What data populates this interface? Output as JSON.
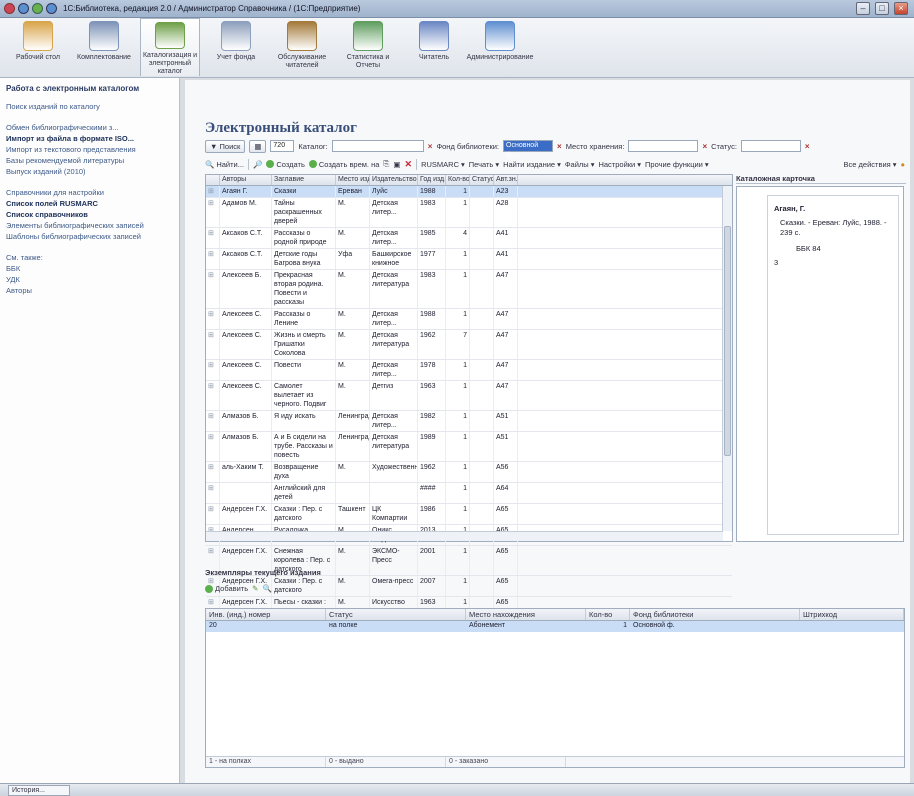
{
  "window": {
    "title": "1С:Библиотека, редакция 2.0 / Администратор Справочника / (1С:Предприятие)",
    "controls": [
      "–",
      "□",
      "×"
    ]
  },
  "sections": [
    {
      "label": "Рабочий стол",
      "icon": "desk-icon",
      "color": "#d9a54a"
    },
    {
      "label": "Комплектование",
      "icon": "books-stack-icon",
      "color": "#7e93b8"
    },
    {
      "label": "Каталогизация и электронный каталог",
      "icon": "catalog-book-icon",
      "color": "#6fa04a",
      "active": true
    },
    {
      "label": "Учет фонда",
      "icon": "ledger-icon",
      "color": "#8d9fbc"
    },
    {
      "label": "Обслуживание читателей",
      "icon": "briefcase-icon",
      "color": "#a47a3a"
    },
    {
      "label": "Статистика и Отчеты",
      "icon": "chart-bars-icon",
      "color": "#5f9e5f"
    },
    {
      "label": "Читатель",
      "icon": "reader-person-icon",
      "color": "#6b87c4"
    },
    {
      "label": "Администрирование",
      "icon": "admin-icon",
      "color": "#5f8fd0"
    }
  ],
  "left_panel": {
    "title": "Работа с электронным каталогом",
    "link1": "Поиск изданий по каталогу",
    "group1": [
      {
        "label": "Обмен библиографическими з...",
        "bold": false
      },
      {
        "label": "Импорт из файла в формате ISO...",
        "bold": true
      },
      {
        "label": "Импорт из текстового представления",
        "bold": false
      },
      {
        "label": "Базы рекомендуемой литературы",
        "bold": false
      },
      {
        "label": "Выпуск изданий (2010)",
        "bold": false
      }
    ],
    "group2": [
      {
        "label": "Справочники для настройки",
        "bold": false
      },
      {
        "label": "Список полей RUSMARC",
        "bold": true
      },
      {
        "label": "Список справочников",
        "bold": true
      },
      {
        "label": "Элементы библиографических записей",
        "bold": false
      },
      {
        "label": "Шаблоны библиографических записей",
        "bold": false
      }
    ],
    "group3": [
      {
        "label": "См. также:",
        "bold": false
      },
      {
        "label": "ББК",
        "bold": false
      },
      {
        "label": "УДК",
        "bold": false
      },
      {
        "label": "Авторы",
        "bold": false
      }
    ]
  },
  "page_title": "Электронный каталог",
  "filters": {
    "search_btn": "Поиск",
    "count": "720",
    "catalog_label": "Каталог:",
    "catalog_value": "",
    "fund_label": "Фонд библиотеки:",
    "fund_value": "Основной ф...",
    "storage_label": "Место хранения:",
    "storage_value": "",
    "status_label": "Статус:",
    "status_value": ""
  },
  "toolbar": {
    "find": "Найти...",
    "create": "Создать",
    "create_based": "Создать врем. на",
    "rusmarc": "RUSMARC",
    "print": "Печать",
    "issue_book": "Найти издание",
    "files": "Файлы",
    "settings": "Настройки",
    "other": "Прочие функции",
    "all_actions": "Все действия"
  },
  "grid": {
    "columns": [
      "",
      "Авторы",
      "Заглавие",
      "Место изд.",
      "Издательство",
      "Год изд.",
      "Кол-во",
      "Статус",
      "Авт.зн."
    ],
    "rows": [
      {
        "author": "Агаян Г.",
        "title": "Сказки",
        "place": "Ереван",
        "publisher": "Луйс",
        "year": "1988",
        "qty": "1",
        "status": "",
        "mark": "А23",
        "selected": true
      },
      {
        "author": "Адамов М.",
        "title": "Тайны раскрашенных дверей",
        "place": "М.",
        "publisher": "Детская литер...",
        "year": "1983",
        "qty": "1",
        "status": "",
        "mark": "А28",
        "selected": false
      },
      {
        "author": "Аксаков С.Т.",
        "title": "Рассказы о родной природе",
        "place": "М.",
        "publisher": "Детская литер...",
        "year": "1985",
        "qty": "4",
        "status": "",
        "mark": "А41",
        "selected": false
      },
      {
        "author": "Аксаков С.Т.",
        "title": "Детские годы Багрова внука",
        "place": "Уфа",
        "publisher": "Башкирское книжное",
        "year": "1977",
        "qty": "1",
        "status": "",
        "mark": "А41",
        "selected": false
      },
      {
        "author": "Алексеев Б.",
        "title": "Прекрасная вторая родина. Повести и рассказы",
        "place": "М.",
        "publisher": "Детская литература",
        "year": "1983",
        "qty": "1",
        "status": "",
        "mark": "А47",
        "selected": false
      },
      {
        "author": "Алексеев С.",
        "title": "Рассказы о Ленине",
        "place": "М.",
        "publisher": "Детская литер...",
        "year": "1988",
        "qty": "1",
        "status": "",
        "mark": "А47",
        "selected": false
      },
      {
        "author": "Алексеев С.",
        "title": "Жизнь и смерть Гришатки Соколова",
        "place": "М.",
        "publisher": "Детская литература",
        "year": "1962",
        "qty": "7",
        "status": "",
        "mark": "А47",
        "selected": false
      },
      {
        "author": "Алексеев С.",
        "title": "Повести",
        "place": "М.",
        "publisher": "Детская литер...",
        "year": "1978",
        "qty": "1",
        "status": "",
        "mark": "А47",
        "selected": false
      },
      {
        "author": "Алексеев С.",
        "title": "Самолет вылетает из черного. Подвиг",
        "place": "М.",
        "publisher": "Детгиз",
        "year": "1963",
        "qty": "1",
        "status": "",
        "mark": "А47",
        "selected": false
      },
      {
        "author": "Алмазов Б.",
        "title": "Я иду искать",
        "place": "Ленинград",
        "publisher": "Детская литер...",
        "year": "1982",
        "qty": "1",
        "status": "",
        "mark": "А51",
        "selected": false
      },
      {
        "author": "Алмазов Б.",
        "title": "А и Б сидели на трубе. Рассказы и повесть",
        "place": "Ленинград",
        "publisher": "Детская литература",
        "year": "1989",
        "qty": "1",
        "status": "",
        "mark": "А51",
        "selected": false
      },
      {
        "author": "аль-Хаким Т.",
        "title": "Возвращение духа",
        "place": "М.",
        "publisher": "Художественн...",
        "year": "1962",
        "qty": "1",
        "status": "",
        "mark": "А56",
        "selected": false
      },
      {
        "author": "",
        "title": "Английский для детей",
        "place": "",
        "publisher": "",
        "year": "####",
        "qty": "1",
        "status": "",
        "mark": "А64",
        "selected": false
      },
      {
        "author": "Андерсен Г.Х.",
        "title": "Сказки : Пер. с датского",
        "place": "Ташкент",
        "publisher": "ЦК Компартии",
        "year": "1986",
        "qty": "1",
        "status": "",
        "mark": "А65",
        "selected": false
      },
      {
        "author": "Андерсен",
        "title": "Русалочка",
        "place": "М.",
        "publisher": "Оникс Медиа Г...",
        "year": "2013",
        "qty": "1",
        "status": "",
        "mark": "А65",
        "selected": false
      },
      {
        "author": "Андерсен Г.Х.",
        "title": "Снежная королева : Пер. с датского",
        "place": "М.",
        "publisher": "ЭКСМО-Пресс",
        "year": "2001",
        "qty": "1",
        "status": "",
        "mark": "А65",
        "selected": false
      },
      {
        "author": "Андерсен Г.Х.",
        "title": "Сказки : Пер. с датского",
        "place": "М.",
        "publisher": "Омега-пресс",
        "year": "2007",
        "qty": "1",
        "status": "",
        "mark": "А65",
        "selected": false
      },
      {
        "author": "Андерсен Г.Х.",
        "title": "Пьесы - сказки : перевод с датского",
        "place": "М.",
        "publisher": "Искусство",
        "year": "1963",
        "qty": "1",
        "status": "",
        "mark": "А65",
        "selected": false
      }
    ]
  },
  "card": {
    "title": "Каталожная карточка",
    "author": "Агаян, Г.",
    "description": "Сказки. - Ереван: Луйс, 1988. - 239 с.",
    "code": "ББК 84",
    "extra": "3"
  },
  "copies": {
    "title": "Экземпляры текущего издания",
    "add_btn": "Добавить",
    "columns": [
      "Инв. (инд.) номер",
      "Статус",
      "Место нахождения",
      "Кол-во",
      "Фонд библиотеки",
      "Штрихкод"
    ],
    "row": {
      "inv": "20",
      "status": "на полке",
      "location": "Абонемент",
      "qty": "1",
      "fund": "Основной ф.",
      "barcode": ""
    },
    "footer": [
      "1 - на полках",
      "0 - выдано",
      "0 - заказано"
    ]
  },
  "statusbar": {
    "history": "История..."
  }
}
